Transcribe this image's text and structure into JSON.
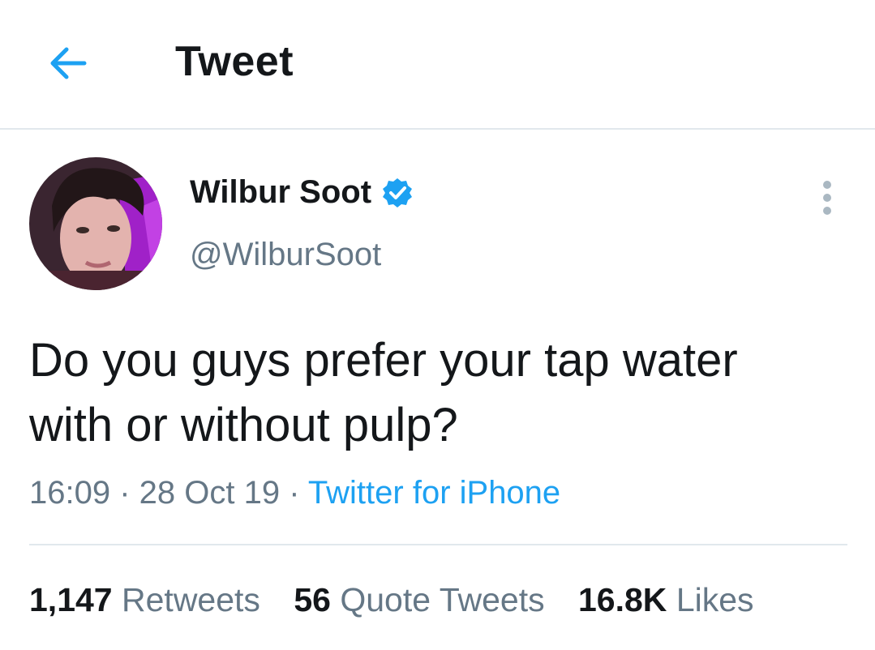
{
  "header": {
    "title": "Tweet",
    "back_icon": "arrow-left-icon"
  },
  "author": {
    "name": "Wilbur Soot",
    "handle": "@WilburSoot",
    "verified_icon": "verified-badge-icon",
    "avatar": "avatar-photo"
  },
  "more_icon": "vertical-ellipsis-icon",
  "tweet": {
    "line1": "Do you guys prefer your tap water",
    "line2": "with or without pulp?"
  },
  "meta": {
    "time": "16:09",
    "sep1": " · ",
    "date": "28 Oct 19",
    "sep2": " · ",
    "source": "Twitter for iPhone"
  },
  "stats": {
    "retweets_count": "1,147",
    "retweets_label": "Retweets",
    "quotes_count": "56",
    "quotes_label": "Quote Tweets",
    "likes_count": "16.8K",
    "likes_label": "Likes"
  },
  "colors": {
    "accent": "#1da1f2",
    "muted": "#657786",
    "text": "#14171a",
    "divider": "#e1e8ed"
  }
}
